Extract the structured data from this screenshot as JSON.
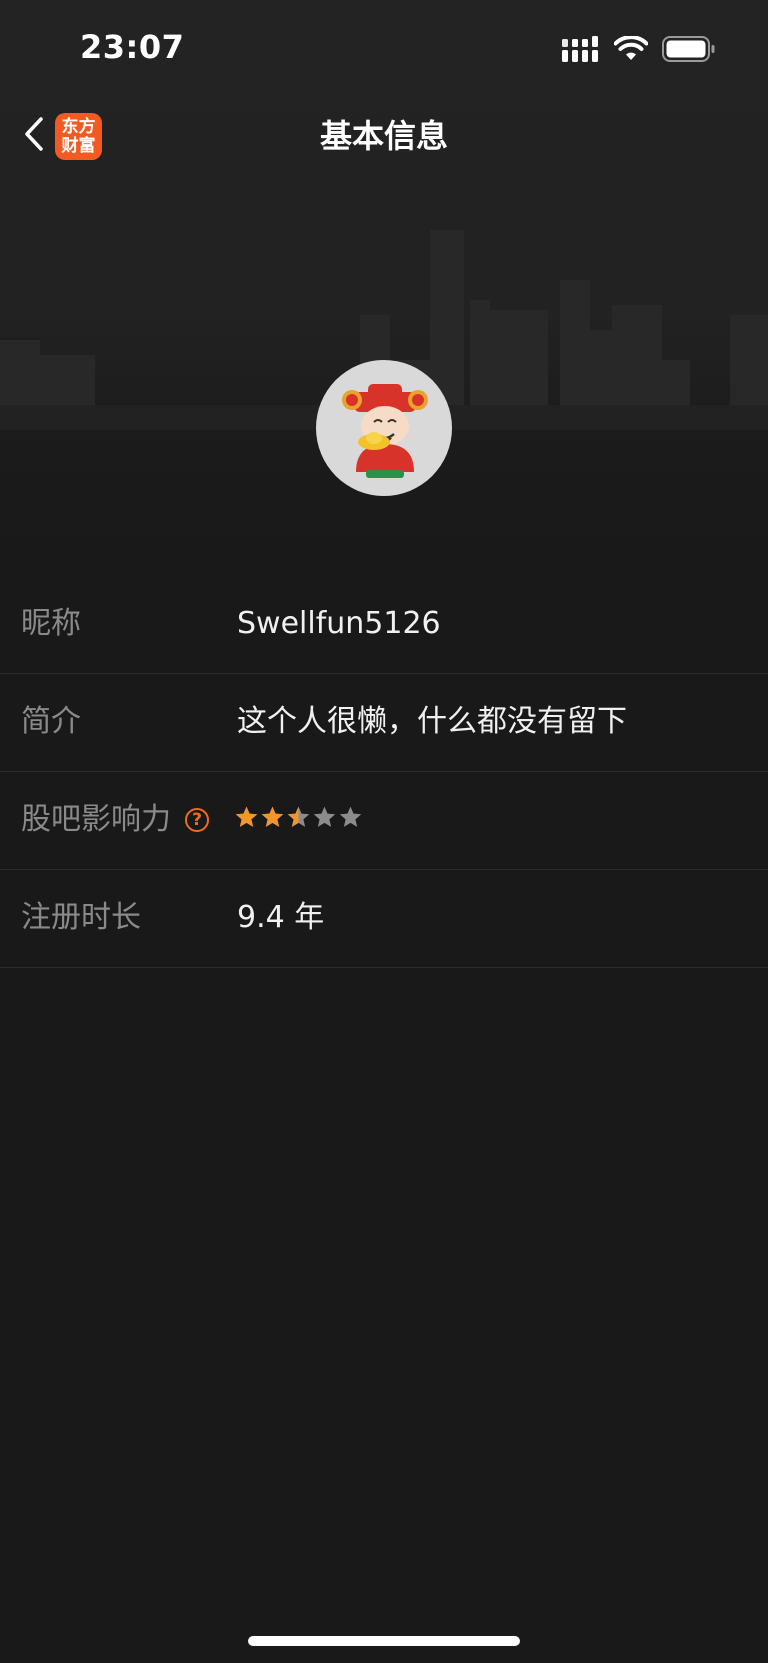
{
  "status_bar": {
    "time": "23:07",
    "icons": [
      "signal-icon",
      "wifi-icon",
      "battery-icon"
    ]
  },
  "nav": {
    "title": "基本信息",
    "back_icon": "chevron-left-icon",
    "logo_line1": "东方",
    "logo_line2": "财富"
  },
  "profile": {
    "avatar_icon": "god-of-wealth-avatar"
  },
  "info": {
    "nickname_label": "昵称",
    "nickname_value": "Swellfun5126",
    "bio_label": "简介",
    "bio_value": "这个人很懒，什么都没有留下",
    "influence_label": "股吧影响力",
    "influence_help": "?",
    "influence_rating": 2.5,
    "influence_max": 5,
    "register_label": "注册时长",
    "register_value": "9.4 年"
  },
  "colors": {
    "background": "#191919",
    "accent": "#f26a21",
    "star_filled": "#f2962b",
    "star_empty": "#8c8c8c",
    "label": "#8a8a8a",
    "value": "#f0f0f0"
  }
}
